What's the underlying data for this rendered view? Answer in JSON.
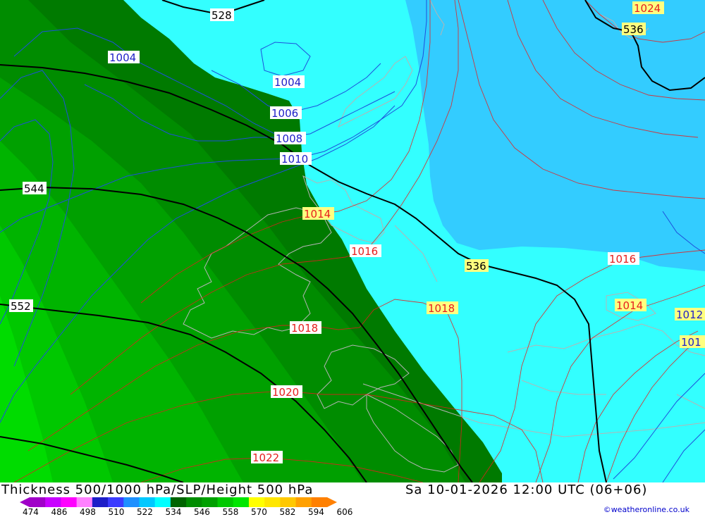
{
  "title_left": "Thickness 500/1000 hPa/SLP/Height 500 hPa",
  "title_right": "Sa 10-01-2026 12:00 UTC (06+06)",
  "credit": "©weatheronline.co.uk",
  "legend": {
    "values": [
      "474",
      "486",
      "498",
      "510",
      "522",
      "534",
      "546",
      "558",
      "570",
      "582",
      "594",
      "606"
    ],
    "colors": [
      "#a000c8",
      "#c800ff",
      "#ff00ff",
      "#ff80ff",
      "#1e1ec8",
      "#3c3cff",
      "#1e90ff",
      "#00c8ff",
      "#00ffff",
      "#006400",
      "#008c00",
      "#00a000",
      "#00c800",
      "#00e600",
      "#ffff00",
      "#ffe600",
      "#ffc800",
      "#ffa000",
      "#ff8000"
    ]
  },
  "map_labels": {
    "height": [
      {
        "text": "528"
      },
      {
        "text": "536"
      },
      {
        "text": "536"
      },
      {
        "text": "544"
      },
      {
        "text": "552"
      }
    ],
    "isobars_blue": [
      {
        "text": "1004"
      },
      {
        "text": "1004"
      },
      {
        "text": "1006"
      },
      {
        "text": "1008"
      },
      {
        "text": "1010"
      }
    ],
    "isobars_red": [
      {
        "text": "1014"
      },
      {
        "text": "1016"
      },
      {
        "text": "1018"
      },
      {
        "text": "1020"
      },
      {
        "text": "1022"
      },
      {
        "text": "1016"
      },
      {
        "text": "1014"
      },
      {
        "text": "1018"
      },
      {
        "text": "1024"
      },
      {
        "text": "1012"
      },
      {
        "text": "101"
      }
    ]
  }
}
